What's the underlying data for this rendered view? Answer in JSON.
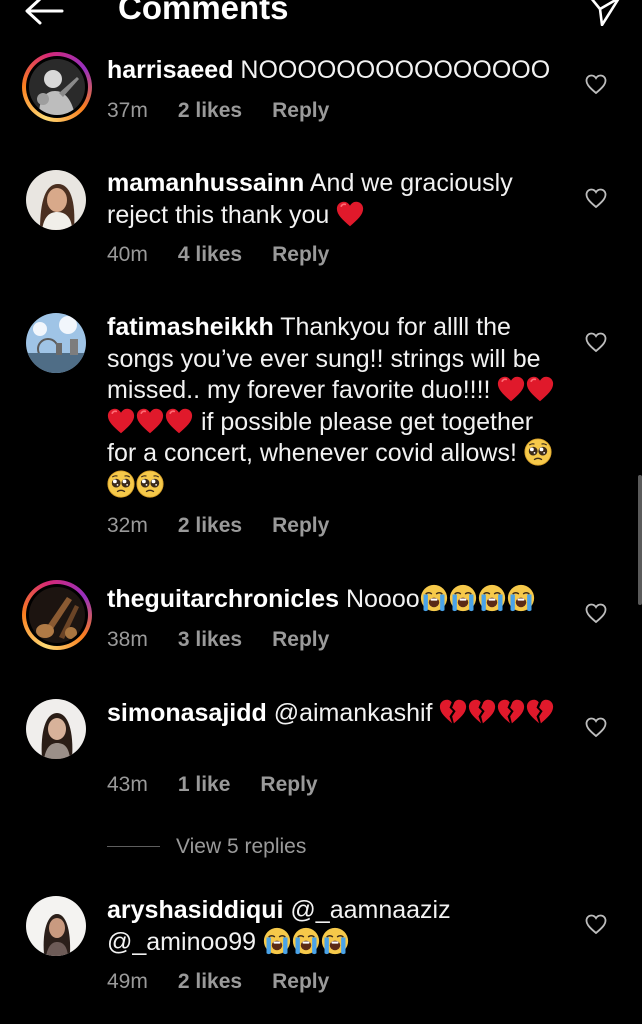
{
  "header": {
    "title": "Comments",
    "back_icon": "arrow-left-icon",
    "share_icon": "paper-plane-icon"
  },
  "comments": [
    {
      "username": "harrisaeed",
      "text": "NOOOOOOOOOOOOOOO",
      "time": "37m",
      "likes": "2 likes",
      "reply": "Reply",
      "has_story": true
    },
    {
      "username": "mamanhussainn",
      "text": "And we graciously reject this thank you",
      "emoji": "red-heart",
      "time": "40m",
      "likes": "4 likes",
      "reply": "Reply",
      "has_story": false
    },
    {
      "username": "fatimasheikkh",
      "text_1": "Thankyou for allll the songs you’ve ever sung!! strings will be missed.. my forever favorite duo!!!!",
      "text_2": "if possible please get together for a concert, whenever covid allows!",
      "emoji_1": "red-heart x5",
      "emoji_2": "pleading-face x3",
      "time": "32m",
      "likes": "2 likes",
      "reply": "Reply",
      "has_story": false
    },
    {
      "username": "theguitarchronicles",
      "text": "Noooo",
      "emoji": "loudly-crying-face x4",
      "time": "38m",
      "likes": "3 likes",
      "reply": "Reply",
      "has_story": true
    },
    {
      "username": "simonasajidd",
      "text": "@aimankashif",
      "emoji": "broken-heart x4",
      "time": "43m",
      "likes": "1 like",
      "reply": "Reply",
      "has_story": false,
      "view_replies": "View 5 replies"
    },
    {
      "username": "aryshasiddiqui",
      "text_1": "@_aamnaaziz",
      "text_2": "@_aminoo99",
      "emoji": "loudly-crying-face x3",
      "time": "49m",
      "likes": "2 likes",
      "reply": "Reply",
      "has_story": false
    }
  ],
  "colors": {
    "background": "#000000",
    "text": "#ffffff",
    "meta": "#9a9a9a",
    "heart_emoji": "#e0192b",
    "story_ring": "#d62976"
  }
}
